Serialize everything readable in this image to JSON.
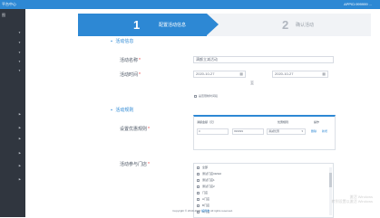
{
  "topbar": {
    "left_text": "平台中心",
    "right_text": "APPID:999999 ..."
  },
  "sidebar": {
    "items": [
      "▼",
      "▼",
      "▼",
      "▼",
      "▼",
      "▶",
      "▶",
      "▶",
      "▶",
      "▶",
      "▶"
    ],
    "partial_label": "图"
  },
  "wizard": {
    "steps": [
      {
        "number": "1",
        "label": "配置活动信息"
      },
      {
        "number": "2",
        "label": "确认活动"
      }
    ]
  },
  "sections": {
    "basic_info": "活动信息",
    "rules": "活动规则"
  },
  "form": {
    "activity_name_label": "活动名称",
    "activity_name_value": "满额立减活动",
    "activity_time_label": "活动时间",
    "start_date": "2020-10-27",
    "end_date": "2020-10-27",
    "to_text": "至",
    "checkbox_label": "是否限制时间段",
    "discount_rules_label": "设置优惠规则",
    "participating_stores_label": "活动参与门店",
    "required_mark": "*"
  },
  "rules_table": {
    "headers": [
      "满额金额（元）",
      "",
      "优惠规则",
      "操作"
    ],
    "amount_value": "0",
    "discount_value": "999999",
    "rule_type": "满减优惠",
    "actions": [
      "删除",
      "新增"
    ]
  },
  "stores": {
    "items": [
      "全部",
      "测试门店CESHI",
      "测试门店1",
      "测试门店2",
      "门店",
      "A门店",
      "B门店",
      "C门店"
    ]
  },
  "footer": {
    "copyright": "Copyright © 2019-2020",
    "link": "超级收",
    "suffix": "All rights reserved."
  },
  "watermark": {
    "line1": "激活 Windows",
    "line2": "转到设置以激活 Windows"
  },
  "colors": {
    "primary": "#2d88d4",
    "sidebar_bg": "#30363f",
    "page_bg": "#ffffff",
    "required": "#ef4444"
  },
  "icons": {
    "calendar": "calendar-icon",
    "caret_down": "caret-down-icon",
    "caret_right": "caret-right-icon"
  }
}
